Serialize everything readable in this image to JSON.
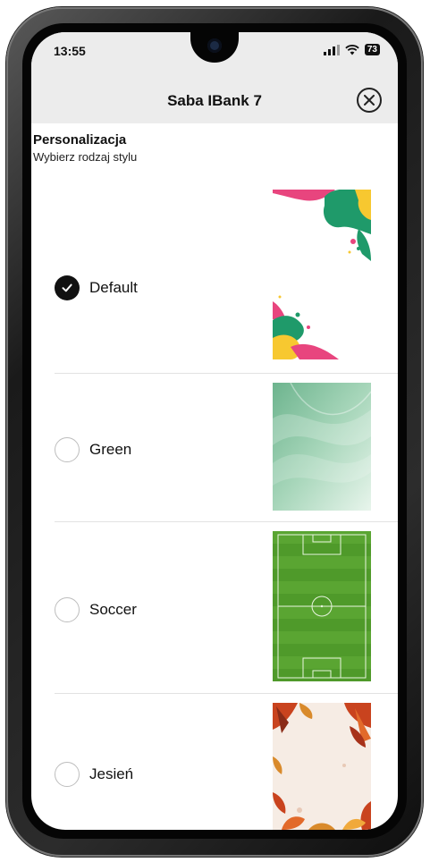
{
  "status_bar": {
    "time": "13:55",
    "battery": "73"
  },
  "header": {
    "title": "Saba IBank 7"
  },
  "section": {
    "title": "Personalizacja",
    "subtitle": "Wybierz rodzaj stylu"
  },
  "options": [
    {
      "label": "Default",
      "selected": true,
      "thumbnail": "pink-green-yellow-abstract"
    },
    {
      "label": "Green",
      "selected": false,
      "thumbnail": "green-gradient-waves"
    },
    {
      "label": "Soccer",
      "selected": false,
      "thumbnail": "soccer-field"
    },
    {
      "label": "Jesień",
      "selected": false,
      "thumbnail": "autumn-leaves"
    }
  ],
  "colors": {
    "header_bg": "#ececec",
    "checked_radio": "#111111",
    "default_pink": "#e8457e",
    "default_green": "#1f9a6a",
    "default_yellow": "#f7c830",
    "soccer_green": "#4f9a2a"
  }
}
